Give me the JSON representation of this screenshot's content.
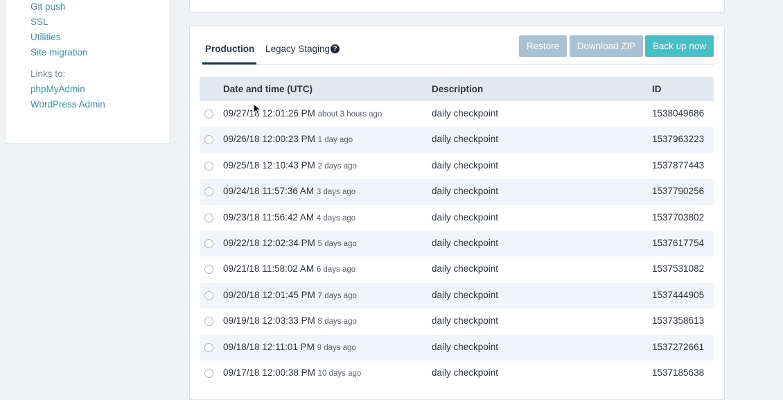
{
  "sidebar": {
    "links": [
      "Git push",
      "SSL",
      "Utilities",
      "Site migration"
    ],
    "links_heading": "Links to:",
    "external_links": [
      "phpMyAdmin",
      "WordPress Admin"
    ]
  },
  "tabs": {
    "production": "Production",
    "legacy": "Legacy Staging",
    "help_glyph": "?"
  },
  "buttons": {
    "restore": "Restore",
    "download": "Download ZIP",
    "backup": "Back up now"
  },
  "table": {
    "headers": {
      "date": "Date and time (UTC)",
      "description": "Description",
      "id": "ID"
    },
    "rows": [
      {
        "date": "09/27/18 12:01:26 PM",
        "ago": "about 3 hours ago",
        "description": "daily checkpoint",
        "id": "1538049686"
      },
      {
        "date": "09/26/18 12:00:23 PM",
        "ago": "1 day ago",
        "description": "daily checkpoint",
        "id": "1537963223"
      },
      {
        "date": "09/25/18 12:10:43 PM",
        "ago": "2 days ago",
        "description": "daily checkpoint",
        "id": "1537877443"
      },
      {
        "date": "09/24/18 11:57:36 AM",
        "ago": "3 days ago",
        "description": "daily checkpoint",
        "id": "1537790256"
      },
      {
        "date": "09/23/18 11:56:42 AM",
        "ago": "4 days ago",
        "description": "daily checkpoint",
        "id": "1537703802"
      },
      {
        "date": "09/22/18 12:02:34 PM",
        "ago": "5 days ago",
        "description": "daily checkpoint",
        "id": "1537617754"
      },
      {
        "date": "09/21/18 11:58:02 AM",
        "ago": "6 days ago",
        "description": "daily checkpoint",
        "id": "1537531082"
      },
      {
        "date": "09/20/18 12:01:45 PM",
        "ago": "7 days ago",
        "description": "daily checkpoint",
        "id": "1537444905"
      },
      {
        "date": "09/19/18 12:03:33 PM",
        "ago": "8 days ago",
        "description": "daily checkpoint",
        "id": "1537358613"
      },
      {
        "date": "09/18/18 12:11:01 PM",
        "ago": "9 days ago",
        "description": "daily checkpoint",
        "id": "1537272661"
      },
      {
        "date": "09/17/18 12:00:38 PM",
        "ago": "10 days ago",
        "description": "daily checkpoint",
        "id": "1537185638"
      }
    ]
  }
}
